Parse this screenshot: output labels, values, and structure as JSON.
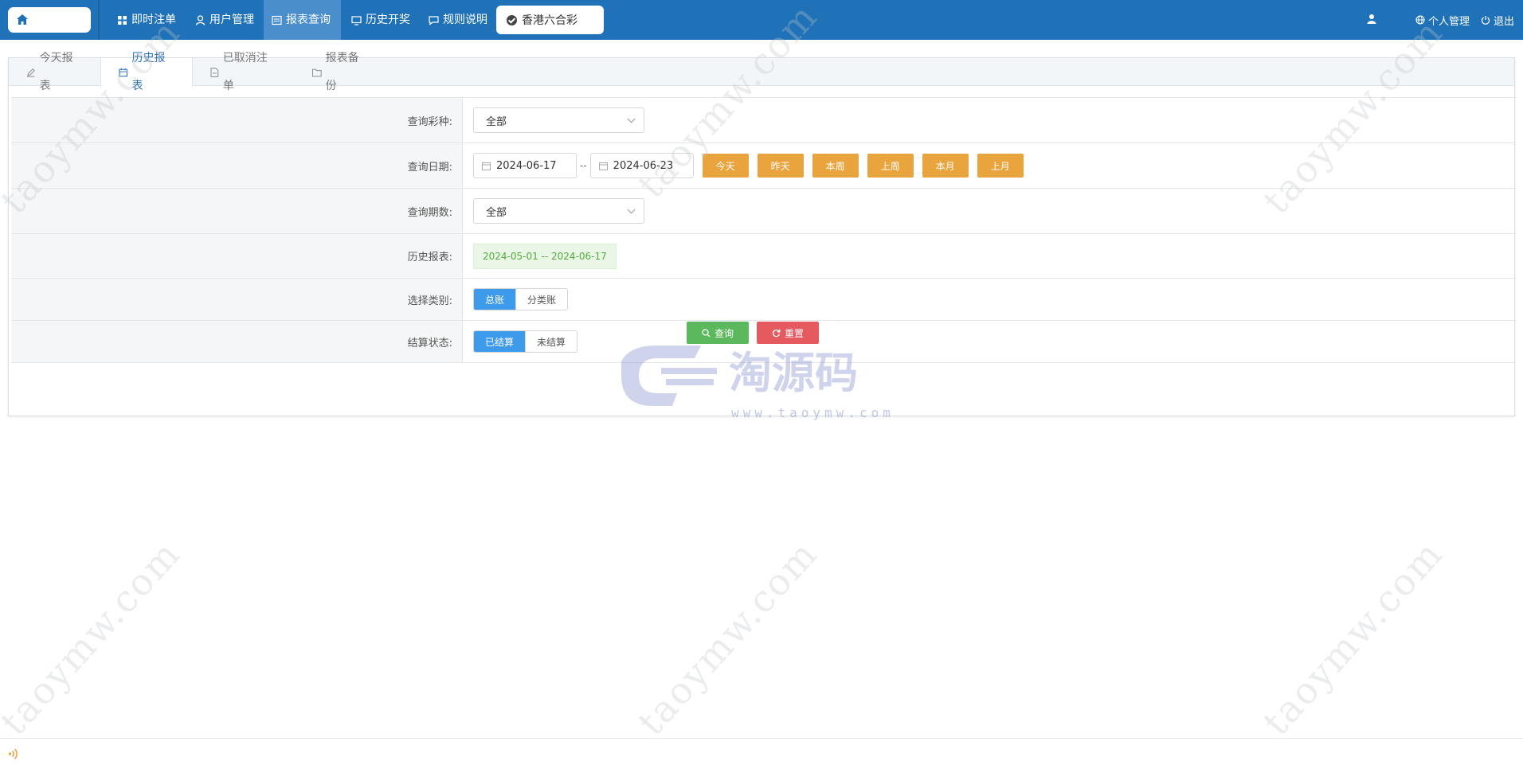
{
  "nav": {
    "items": [
      {
        "label": "即时注单",
        "icon": "grid-icon"
      },
      {
        "label": "用户管理",
        "icon": "user-icon"
      },
      {
        "label": "报表查询",
        "icon": "report-icon"
      },
      {
        "label": "历史开奖",
        "icon": "monitor-icon"
      },
      {
        "label": "规则说明",
        "icon": "chat-icon"
      }
    ],
    "lottery": "香港六合彩",
    "personal": "个人管理",
    "logout": "退出"
  },
  "tabs": [
    {
      "label": "今天报表",
      "icon": "pencil-icon"
    },
    {
      "label": "历史报表",
      "icon": "calendar-icon"
    },
    {
      "label": "已取消注单",
      "icon": "file-icon"
    },
    {
      "label": "报表备份",
      "icon": "folder-icon"
    }
  ],
  "form": {
    "lottery_type": {
      "label": "查询彩种:",
      "value": "全部"
    },
    "date": {
      "label": "查询日期:",
      "start": "2024-06-17",
      "end": "2024-06-23",
      "separator": "--",
      "quick": [
        "今天",
        "昨天",
        "本周",
        "上周",
        "本月",
        "上月"
      ]
    },
    "period": {
      "label": "查询期数:",
      "value": "全部"
    },
    "history": {
      "label": "历史报表:",
      "value": "2024-05-01 -- 2024-06-17"
    },
    "category": {
      "label": "选择类别:",
      "options": [
        "总账",
        "分类账"
      ],
      "selected": "总账"
    },
    "status": {
      "label": "结算状态:",
      "options": [
        "已结算",
        "未结算"
      ],
      "selected": "已结算"
    }
  },
  "actions": {
    "query": "查询",
    "reset": "重置"
  },
  "watermark": {
    "text": "taoymw.com",
    "brand": "淘源码",
    "url": "www.taoymw.com"
  },
  "colors": {
    "primary": "#1f72b8",
    "orange": "#eaa43d",
    "green": "#5cb85c",
    "red": "#e45a5e",
    "blue": "#3e9bec"
  }
}
